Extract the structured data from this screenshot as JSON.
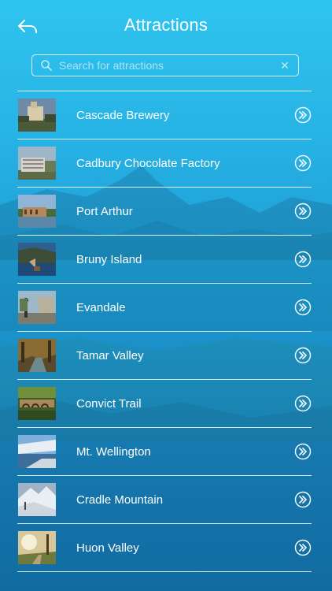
{
  "header": {
    "title": "Attractions",
    "back_icon": "back-arrow-icon"
  },
  "search": {
    "placeholder": "Search for attractions",
    "value": "",
    "search_icon": "search-icon",
    "clear_icon": "clear-icon"
  },
  "colors": {
    "background_top": "#2fc4ef",
    "background_bottom": "#1170aa",
    "text": "#ffffff",
    "divider": "#ffffff"
  },
  "attractions": [
    {
      "label": "Cascade Brewery",
      "action_icon": "chevron-double-right-icon"
    },
    {
      "label": "Cadbury Chocolate Factory",
      "action_icon": "chevron-double-right-icon"
    },
    {
      "label": "Port Arthur",
      "action_icon": "chevron-double-right-icon"
    },
    {
      "label": "Bruny Island",
      "action_icon": "chevron-double-right-icon"
    },
    {
      "label": "Evandale",
      "action_icon": "chevron-double-right-icon"
    },
    {
      "label": "Tamar Valley",
      "action_icon": "chevron-double-right-icon"
    },
    {
      "label": "Convict Trail",
      "action_icon": "chevron-double-right-icon"
    },
    {
      "label": "Mt. Wellington",
      "action_icon": "chevron-double-right-icon"
    },
    {
      "label": "Cradle Mountain",
      "action_icon": "chevron-double-right-icon"
    },
    {
      "label": "Huon Valley",
      "action_icon": "chevron-double-right-icon"
    }
  ]
}
